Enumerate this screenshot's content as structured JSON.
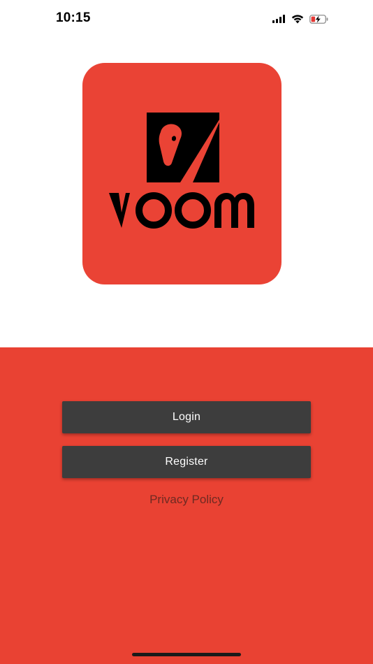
{
  "status_bar": {
    "time": "10:15",
    "icons": [
      "cellular-signal-icon",
      "wifi-icon",
      "battery-charging-icon"
    ],
    "battery_color": "#e53935"
  },
  "logo": {
    "wordmark": "voom",
    "background_color": "#ea4335"
  },
  "actions": {
    "login_label": "Login",
    "register_label": "Register",
    "privacy_label": "Privacy Policy"
  },
  "colors": {
    "panel": "#e94233",
    "button": "#3d3d3d",
    "button_text": "#ffffff",
    "link": "#6e2a22"
  }
}
